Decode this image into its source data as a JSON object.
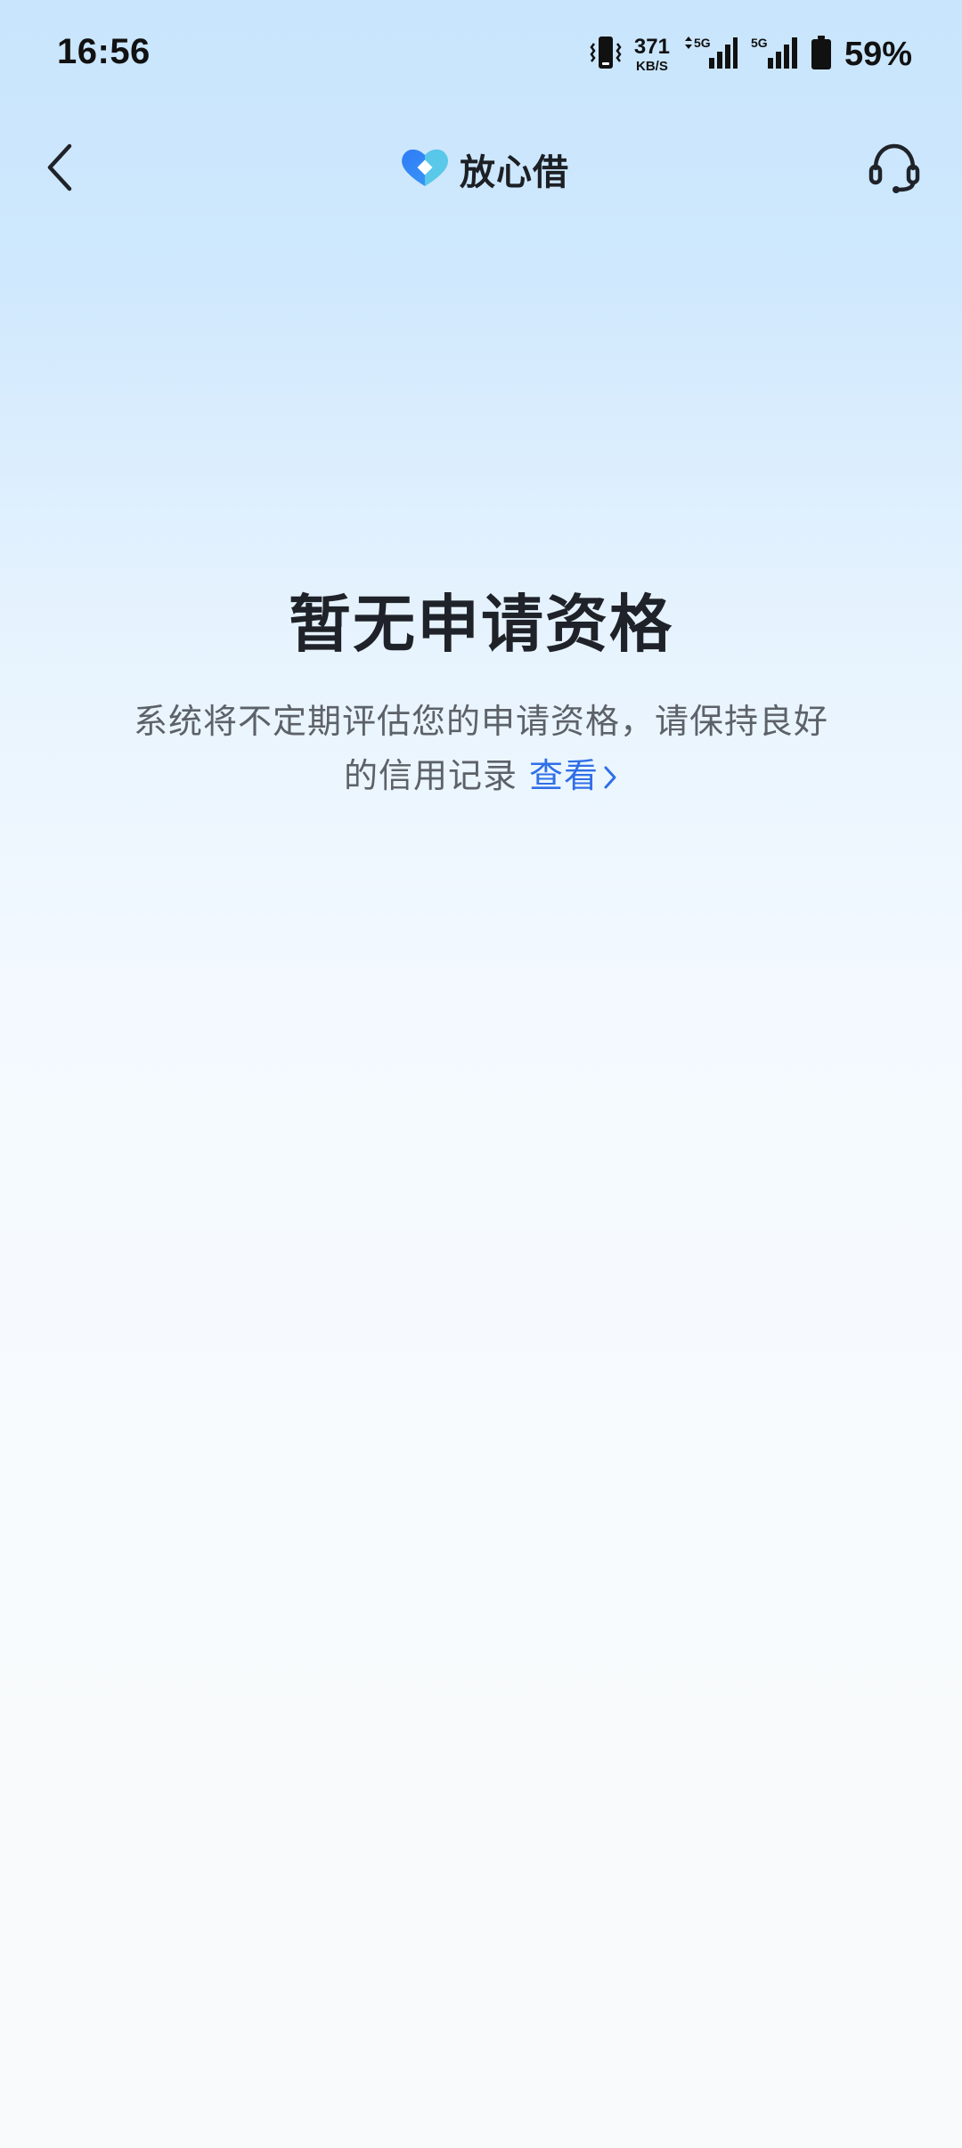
{
  "status_bar": {
    "time": "16:56",
    "net_speed_value": "371",
    "net_speed_unit": "KB/S",
    "battery_percent": "59%",
    "icons": [
      "vibrate-icon",
      "signal-5g-icon",
      "signal-5g-icon",
      "battery-icon"
    ]
  },
  "nav": {
    "brand_name": "放心借",
    "brand_colors": [
      "#2f7cf6",
      "#5fd2e6"
    ],
    "back_icon": "chevron-left-icon",
    "service_icon": "headset-icon"
  },
  "empty_state": {
    "title": "暂无申请资格",
    "description": "系统将不定期评估您的申请资格，请保持良好的信用记录",
    "link_label": "查看",
    "link_color": "#2f6fe8"
  }
}
